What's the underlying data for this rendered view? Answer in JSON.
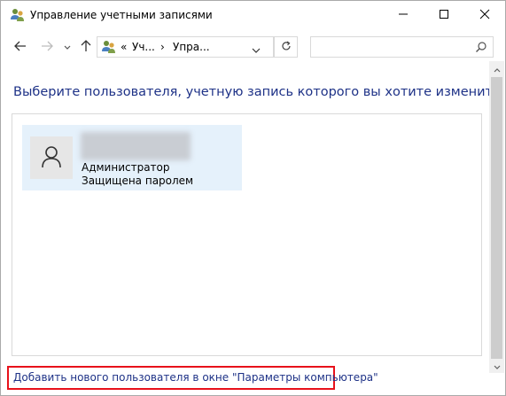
{
  "window": {
    "title": "Управление учетными записями"
  },
  "controls": {
    "minimize_icon": "minimize-icon",
    "maximize_icon": "maximize-icon",
    "close_icon": "close-icon"
  },
  "nav": {
    "back_icon": "arrow-left-icon",
    "forward_icon": "arrow-right-icon",
    "recent_icon": "chevron-down-icon",
    "up_icon": "arrow-up-icon",
    "breadcrumb_sep1": "«",
    "breadcrumb_1": "Уч...",
    "breadcrumb_sep2": "›",
    "breadcrumb_2": "Упра...",
    "search_placeholder": ""
  },
  "main": {
    "heading": "Выберите пользователя, учетную запись которого вы хотите изменить",
    "account": {
      "role": "Администратор",
      "status": "Защищена паролем"
    },
    "add_user_link": "Добавить нового пользователя в окне \"Параметры компьютера\""
  },
  "colors": {
    "link": "#1e3287",
    "tile_bg": "#e5f1fb",
    "highlight": "#e8111b"
  }
}
